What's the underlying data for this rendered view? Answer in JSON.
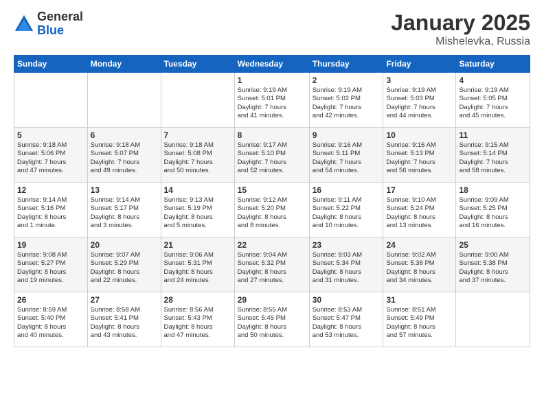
{
  "logo": {
    "general": "General",
    "blue": "Blue"
  },
  "title": "January 2025",
  "location": "Mishelevka, Russia",
  "days_header": [
    "Sunday",
    "Monday",
    "Tuesday",
    "Wednesday",
    "Thursday",
    "Friday",
    "Saturday"
  ],
  "weeks": [
    [
      {
        "day": "",
        "info": ""
      },
      {
        "day": "",
        "info": ""
      },
      {
        "day": "",
        "info": ""
      },
      {
        "day": "1",
        "info": "Sunrise: 9:19 AM\nSunset: 5:01 PM\nDaylight: 7 hours\nand 41 minutes."
      },
      {
        "day": "2",
        "info": "Sunrise: 9:19 AM\nSunset: 5:02 PM\nDaylight: 7 hours\nand 42 minutes."
      },
      {
        "day": "3",
        "info": "Sunrise: 9:19 AM\nSunset: 5:03 PM\nDaylight: 7 hours\nand 44 minutes."
      },
      {
        "day": "4",
        "info": "Sunrise: 9:19 AM\nSunset: 5:05 PM\nDaylight: 7 hours\nand 45 minutes."
      }
    ],
    [
      {
        "day": "5",
        "info": "Sunrise: 9:18 AM\nSunset: 5:06 PM\nDaylight: 7 hours\nand 47 minutes."
      },
      {
        "day": "6",
        "info": "Sunrise: 9:18 AM\nSunset: 5:07 PM\nDaylight: 7 hours\nand 49 minutes."
      },
      {
        "day": "7",
        "info": "Sunrise: 9:18 AM\nSunset: 5:08 PM\nDaylight: 7 hours\nand 50 minutes."
      },
      {
        "day": "8",
        "info": "Sunrise: 9:17 AM\nSunset: 5:10 PM\nDaylight: 7 hours\nand 52 minutes."
      },
      {
        "day": "9",
        "info": "Sunrise: 9:16 AM\nSunset: 5:11 PM\nDaylight: 7 hours\nand 54 minutes."
      },
      {
        "day": "10",
        "info": "Sunrise: 9:16 AM\nSunset: 5:13 PM\nDaylight: 7 hours\nand 56 minutes."
      },
      {
        "day": "11",
        "info": "Sunrise: 9:15 AM\nSunset: 5:14 PM\nDaylight: 7 hours\nand 58 minutes."
      }
    ],
    [
      {
        "day": "12",
        "info": "Sunrise: 9:14 AM\nSunset: 5:16 PM\nDaylight: 8 hours\nand 1 minute."
      },
      {
        "day": "13",
        "info": "Sunrise: 9:14 AM\nSunset: 5:17 PM\nDaylight: 8 hours\nand 3 minutes."
      },
      {
        "day": "14",
        "info": "Sunrise: 9:13 AM\nSunset: 5:19 PM\nDaylight: 8 hours\nand 5 minutes."
      },
      {
        "day": "15",
        "info": "Sunrise: 9:12 AM\nSunset: 5:20 PM\nDaylight: 8 hours\nand 8 minutes."
      },
      {
        "day": "16",
        "info": "Sunrise: 9:11 AM\nSunset: 5:22 PM\nDaylight: 8 hours\nand 10 minutes."
      },
      {
        "day": "17",
        "info": "Sunrise: 9:10 AM\nSunset: 5:24 PM\nDaylight: 8 hours\nand 13 minutes."
      },
      {
        "day": "18",
        "info": "Sunrise: 9:09 AM\nSunset: 5:25 PM\nDaylight: 8 hours\nand 16 minutes."
      }
    ],
    [
      {
        "day": "19",
        "info": "Sunrise: 9:08 AM\nSunset: 5:27 PM\nDaylight: 8 hours\nand 19 minutes."
      },
      {
        "day": "20",
        "info": "Sunrise: 9:07 AM\nSunset: 5:29 PM\nDaylight: 8 hours\nand 22 minutes."
      },
      {
        "day": "21",
        "info": "Sunrise: 9:06 AM\nSunset: 5:31 PM\nDaylight: 8 hours\nand 24 minutes."
      },
      {
        "day": "22",
        "info": "Sunrise: 9:04 AM\nSunset: 5:32 PM\nDaylight: 8 hours\nand 27 minutes."
      },
      {
        "day": "23",
        "info": "Sunrise: 9:03 AM\nSunset: 5:34 PM\nDaylight: 8 hours\nand 31 minutes."
      },
      {
        "day": "24",
        "info": "Sunrise: 9:02 AM\nSunset: 5:36 PM\nDaylight: 8 hours\nand 34 minutes."
      },
      {
        "day": "25",
        "info": "Sunrise: 9:00 AM\nSunset: 5:38 PM\nDaylight: 8 hours\nand 37 minutes."
      }
    ],
    [
      {
        "day": "26",
        "info": "Sunrise: 8:59 AM\nSunset: 5:40 PM\nDaylight: 8 hours\nand 40 minutes."
      },
      {
        "day": "27",
        "info": "Sunrise: 8:58 AM\nSunset: 5:41 PM\nDaylight: 8 hours\nand 43 minutes."
      },
      {
        "day": "28",
        "info": "Sunrise: 8:56 AM\nSunset: 5:43 PM\nDaylight: 8 hours\nand 47 minutes."
      },
      {
        "day": "29",
        "info": "Sunrise: 8:55 AM\nSunset: 5:45 PM\nDaylight: 8 hours\nand 50 minutes."
      },
      {
        "day": "30",
        "info": "Sunrise: 8:53 AM\nSunset: 5:47 PM\nDaylight: 8 hours\nand 53 minutes."
      },
      {
        "day": "31",
        "info": "Sunrise: 8:51 AM\nSunset: 5:49 PM\nDaylight: 8 hours\nand 57 minutes."
      },
      {
        "day": "",
        "info": ""
      }
    ]
  ]
}
